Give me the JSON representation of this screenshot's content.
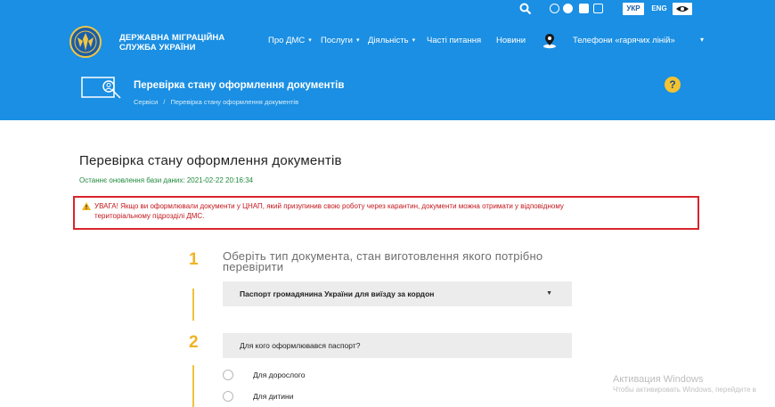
{
  "header": {
    "brand_line1": "ДЕРЖАВНА МІГРАЦІЙНА",
    "brand_line2": "СЛУЖБА УКРАЇНИ",
    "nav": [
      "Про ДМС",
      "Послуги",
      "Діяльність",
      "Часті питання",
      "Новини",
      "Телефони «гарячих ліній»"
    ],
    "lang_active": "УКР",
    "lang_other": "ENG",
    "bg_color": "#1a8fe3"
  },
  "page_header": {
    "title": "Перевірка стану оформлення документів",
    "breadcrumb": [
      "Сервіси",
      "Перевірка стану оформлення документів"
    ],
    "help_symbol": "?"
  },
  "main": {
    "title": "Перевірка стану оформлення документів",
    "update_label": "Останнє оновлення бази даних: 2021-02-22 20:16:34",
    "alert_line1": "УВАГА! Якщо ви оформлювали документи у ЦНАП, який призупинив свою роботу через карантин, документи можна отримати у відповідному",
    "alert_line2": "територіальному підрозділі ДМС.",
    "step1": {
      "number": "1",
      "title": "Оберіть тип документа, стан виготовлення якого потрібно перевірити",
      "selected": "Паспорт громадянина України для виїзду за кордон"
    },
    "step2": {
      "number": "2",
      "question": "Для кого оформлювався паспорт?",
      "options": [
        "Для дорослого",
        "Для дитини"
      ]
    }
  },
  "watermark": {
    "title": "Активация Windows",
    "subtitle": "Чтобы активировать Windows, перейдите в"
  },
  "colors": {
    "accent": "#1a8fe3",
    "alert": "#d9252b",
    "step": "#f0b321",
    "update": "#1f8a3c"
  }
}
